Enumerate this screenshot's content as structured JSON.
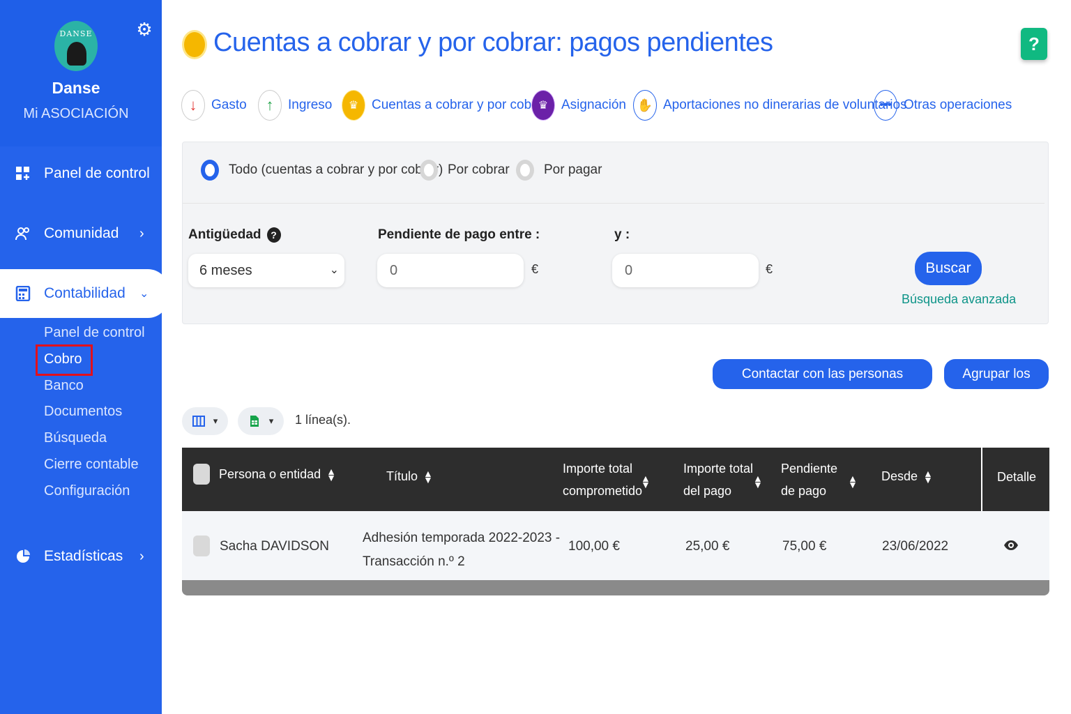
{
  "sidebar": {
    "org_logo_text": "DANSE",
    "org_name": "Danse",
    "org_subtitle": "Mi ASOCIACIÓN",
    "nav": [
      {
        "label": "Panel de control",
        "icon": "dashboard-icon"
      },
      {
        "label": "Comunidad",
        "icon": "users-icon"
      },
      {
        "label": "Contabilidad",
        "icon": "calculator-icon"
      },
      {
        "label": "Estadísticas",
        "icon": "chart-pie-icon"
      }
    ],
    "sub": [
      "Panel de control",
      "Cobro",
      "Banco",
      "Documentos",
      "Búsqueda",
      "Cierre contable",
      "Configuración"
    ]
  },
  "header": {
    "title": "Cuentas a cobrar y por cobrar: pagos pendientes",
    "help": "?"
  },
  "categories": [
    {
      "label": "Gasto",
      "icon": "arrow-down-icon",
      "color": "#e53935"
    },
    {
      "label": "Ingreso",
      "icon": "arrow-up-icon",
      "color": "#22a34a"
    },
    {
      "label": "Cuentas a cobrar y por cobrar",
      "icon": "crown-icon",
      "color": "#f5b700"
    },
    {
      "label": "Asignación",
      "icon": "crown-star-icon",
      "color": "#6b21a8"
    },
    {
      "label": "Aportaciones no dinerarias de voluntarios",
      "icon": "hand-icon",
      "color": "#2563eb"
    },
    {
      "label": "Otras operaciones",
      "icon": "dots-icon",
      "color": "#2563eb"
    }
  ],
  "filters": {
    "radios": [
      "Todo (cuentas a cobrar y por cobrar)",
      "Por cobrar",
      "Por pagar"
    ],
    "antiguedad_label": "Antigüedad",
    "antiguedad_value": "6 meses",
    "pendiente_label": "Pendiente de pago entre :",
    "pendiente_value": "0",
    "y_label": "y :",
    "y_value": "0",
    "currency": "€",
    "search_button": "Buscar",
    "advanced_link": "Búsqueda avanzada"
  },
  "actions": {
    "contact": "Contactar con las personas seleccionadas",
    "group": "Agrupar los pagos",
    "lines": "1 línea(s)."
  },
  "table": {
    "headers": {
      "persona": "Persona o entidad",
      "titulo": "Título",
      "importe_comp_1": "Importe total",
      "importe_comp_2": "comprometido",
      "importe_pago_1": "Importe total",
      "importe_pago_2": "del pago",
      "pendiente_1": "Pendiente",
      "pendiente_2": "de pago",
      "desde": "Desde",
      "detalle": "Detalle"
    },
    "rows": [
      {
        "persona": "Sacha DAVIDSON",
        "titulo_1": "Adhesión temporada 2022-2023 -",
        "titulo_2": "Transacción n.º 2",
        "importe_comp": "100,00 €",
        "importe_pago": "25,00 €",
        "pendiente": "75,00 €",
        "desde": "23/06/2022"
      }
    ]
  }
}
